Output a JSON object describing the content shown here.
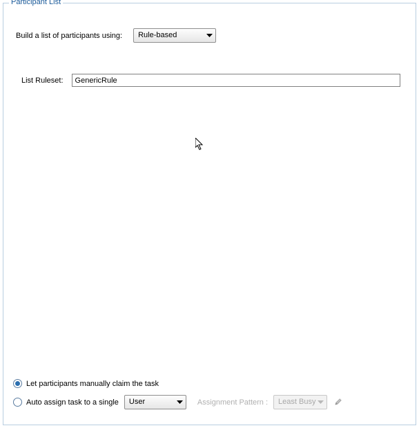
{
  "fieldset": {
    "title": "Participant List"
  },
  "buildRow": {
    "label": "Build a list of participants using:",
    "selected": "Rule-based"
  },
  "rulesetRow": {
    "label": "List Ruleset:",
    "value": "GenericRule"
  },
  "bottom": {
    "radio1": {
      "label": "Let participants manually claim the task",
      "checked": true
    },
    "radio2": {
      "label": "Auto assign task to a single",
      "checked": false,
      "selectValue": "User"
    },
    "assignmentLabel": "Assignment Pattern :",
    "assignmentValue": "Least Busy"
  }
}
